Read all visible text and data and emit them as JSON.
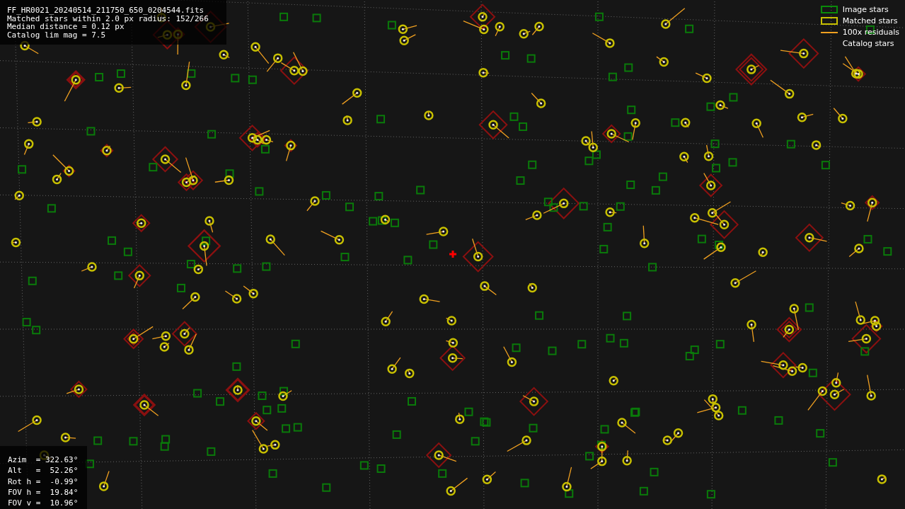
{
  "info": {
    "lines": [
      "FF_HR0021_20240514_211750_650_0204544.fits",
      "Matched stars within 2.0 px radius: 152/266",
      "Median distance = 0.12 px",
      "Catalog lim mag = 7.5"
    ]
  },
  "legend": [
    {
      "kind": "image",
      "label": "Image stars"
    },
    {
      "kind": "matched",
      "label": "Matched stars"
    },
    {
      "kind": "residual",
      "label": "100x residuals"
    },
    {
      "kind": "catalog",
      "label": "Catalog stars"
    }
  ],
  "pointing": {
    "lines": [
      "Azim  = 322.63°",
      "Alt   =  52.26°",
      "Rot h =  -0.99°",
      "FOV h =  19.84°",
      "FOV v =  10.96°"
    ]
  }
}
